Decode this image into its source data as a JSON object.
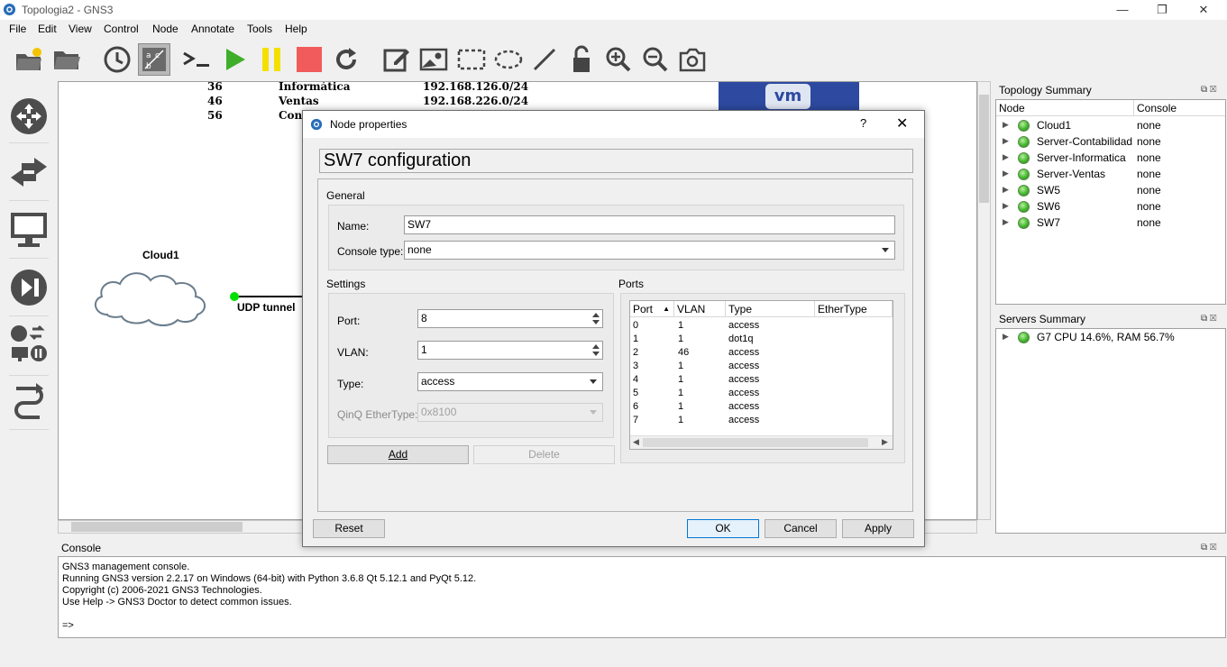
{
  "window": {
    "title": "Topologia2 - GNS3",
    "minimize": "—",
    "restore": "❐",
    "close": "✕"
  },
  "menu": [
    "File",
    "Edit",
    "View",
    "Control",
    "Node",
    "Annotate",
    "Tools",
    "Help"
  ],
  "canvas": {
    "vlan_rows": [
      {
        "id": "36",
        "name": "Informática",
        "network": "192.168.126.0/24"
      },
      {
        "id": "46",
        "name": "Ventas",
        "network": "192.168.226.0/24"
      },
      {
        "id": "56",
        "name": "Cont",
        "network": ""
      }
    ],
    "cloud_label": "Cloud1",
    "link_label": "UDP tunnel",
    "vm_badge": "vm"
  },
  "topology_summary": {
    "title": "Topology Summary",
    "col_node": "Node",
    "col_console": "Console",
    "nodes": [
      {
        "name": "Cloud1",
        "console": "none"
      },
      {
        "name": "Server-Contabilidad",
        "console": "none"
      },
      {
        "name": "Server-Informatica",
        "console": "none"
      },
      {
        "name": "Server-Ventas",
        "console": "none"
      },
      {
        "name": "SW5",
        "console": "none"
      },
      {
        "name": "SW6",
        "console": "none"
      },
      {
        "name": "SW7",
        "console": "none"
      }
    ]
  },
  "servers_summary": {
    "title": "Servers Summary",
    "servers": [
      {
        "label": "G7 CPU 14.6%, RAM 56.7%"
      }
    ]
  },
  "console": {
    "title": "Console",
    "lines": [
      "GNS3 management console.",
      "Running GNS3 version 2.2.17 on Windows (64-bit) with Python 3.6.8 Qt 5.12.1 and PyQt 5.12.",
      "Copyright (c) 2006-2021 GNS3 Technologies.",
      "Use Help -> GNS3 Doctor to detect common issues.",
      "",
      "=>"
    ]
  },
  "dialog": {
    "title": "Node properties",
    "help": "?",
    "close": "✕",
    "header": "SW7 configuration",
    "general": {
      "label": "General",
      "name_label": "Name:",
      "name_value": "SW7",
      "console_type_label": "Console type:",
      "console_type_value": "none"
    },
    "settings": {
      "label": "Settings",
      "port_label": "Port:",
      "port_value": "8",
      "vlan_label": "VLAN:",
      "vlan_value": "1",
      "type_label": "Type:",
      "type_value": "access",
      "qinq_label": "QinQ EtherType:",
      "qinq_value": "0x8100",
      "add": "Add",
      "delete": "Delete"
    },
    "ports": {
      "label": "Ports",
      "columns": [
        "Port",
        "VLAN",
        "Type",
        "EtherType"
      ],
      "rows": [
        [
          "0",
          "1",
          "access",
          ""
        ],
        [
          "1",
          "1",
          "dot1q",
          ""
        ],
        [
          "2",
          "46",
          "access",
          ""
        ],
        [
          "3",
          "1",
          "access",
          ""
        ],
        [
          "4",
          "1",
          "access",
          ""
        ],
        [
          "5",
          "1",
          "access",
          ""
        ],
        [
          "6",
          "1",
          "access",
          ""
        ],
        [
          "7",
          "1",
          "access",
          ""
        ]
      ]
    },
    "buttons": {
      "reset": "Reset",
      "ok": "OK",
      "cancel": "Cancel",
      "apply": "Apply"
    }
  }
}
